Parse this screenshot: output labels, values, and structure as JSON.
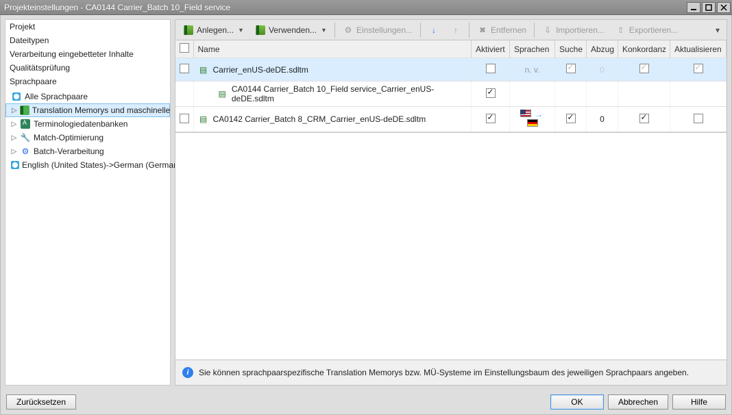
{
  "window": {
    "title": "Projekteinstellungen - CA0144 Carrier_Batch 10_Field service"
  },
  "sidebar": {
    "items": [
      "Projekt",
      "Dateitypen",
      "Verarbeitung eingebetteter Inhalte",
      "Qualitätsprüfung",
      "Sprachpaare"
    ],
    "tree": {
      "all_lang": "Alle Sprachpaare",
      "tm": "Translation Memorys und maschinelle",
      "term": "Terminologiedatenbanken",
      "match": "Match-Optimierung",
      "batch": "Batch-Verarbeitung",
      "pair": "English (United States)->German (German"
    }
  },
  "toolbar": {
    "anlegen": "Anlegen...",
    "verwenden": "Verwenden...",
    "einstellungen": "Einstellungen...",
    "entfernen": "Entfernen",
    "importieren": "Importieren...",
    "exportieren": "Exportieren..."
  },
  "grid": {
    "headers": {
      "name": "Name",
      "aktiviert": "Aktiviert",
      "sprachen": "Sprachen",
      "suche": "Suche",
      "abzug": "Abzug",
      "konkordanz": "Konkordanz",
      "aktualisieren": "Aktualisieren"
    },
    "rows": [
      {
        "name": "Carrier_enUS-deDE.sdltm",
        "aktiviert": false,
        "sprachen": "n. v.",
        "suche": "checked-dim",
        "abzug": "0-dim",
        "konkordanz": "checked-dim",
        "aktualisieren": "checked-dim"
      },
      {
        "name": "CA0144 Carrier_Batch 10_Field service_Carrier_enUS-deDE.sdltm",
        "aktiviert": true
      },
      {
        "name": "CA0142 Carrier_Batch 8_CRM_Carrier_enUS-deDE.sdltm",
        "aktiviert": true,
        "sprachen": "flags",
        "suche": "checked",
        "abzug": "0",
        "konkordanz": "checked",
        "aktualisieren": "unchecked"
      }
    ]
  },
  "info": "Sie können sprachpaarspezifische Translation Memorys bzw. MÜ-Systeme im Einstellungsbaum des jeweiligen Sprachpaars angeben.",
  "buttons": {
    "reset": "Zurücksetzen",
    "ok": "OK",
    "cancel": "Abbrechen",
    "help": "Hilfe"
  }
}
